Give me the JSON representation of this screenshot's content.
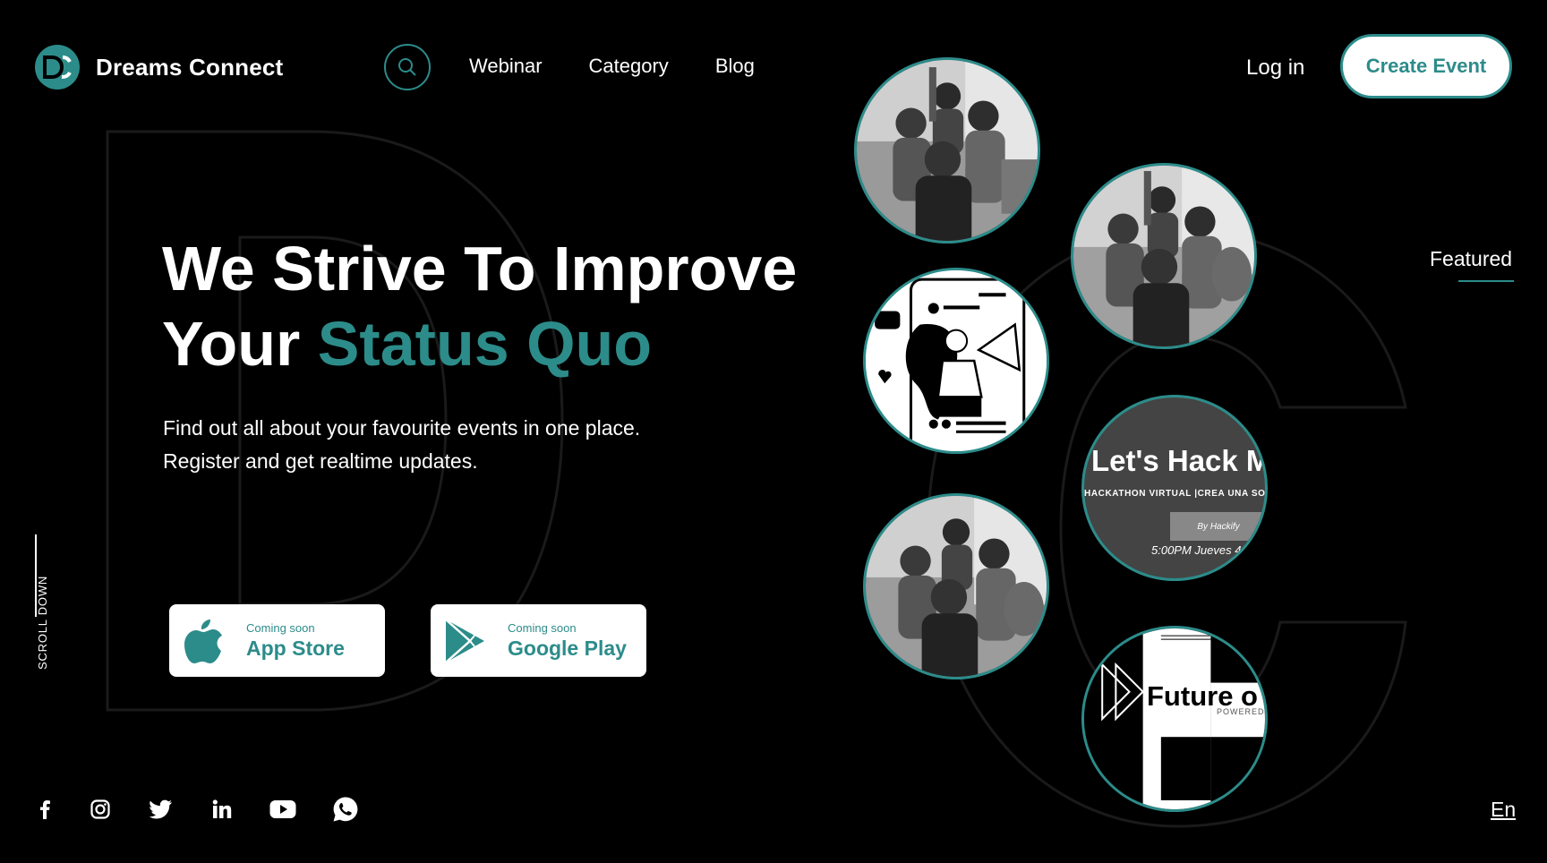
{
  "brand": {
    "logo_letters": "DC",
    "name": "Dreams Connect"
  },
  "colors": {
    "accent": "#2c8c8a",
    "background": "#000000",
    "text": "#ffffff"
  },
  "nav": {
    "search_icon": "search-icon",
    "items": [
      {
        "label": "Webinar"
      },
      {
        "label": "Category"
      },
      {
        "label": "Blog"
      }
    ]
  },
  "auth": {
    "login_label": "Log in",
    "create_label": "Create Event"
  },
  "hero": {
    "title_line1": "We Strive To Improve",
    "title_line2_prefix": "Your ",
    "title_line2_accent": "Status Quo",
    "subtitle_line1": "Find out all about your favourite events in one place.",
    "subtitle_line2": "Register and get realtime updates."
  },
  "stores": [
    {
      "icon": "apple-icon",
      "small": "Coming soon",
      "big": "App Store"
    },
    {
      "icon": "google-play-icon",
      "small": "Coming soon",
      "big": "Google Play"
    }
  ],
  "scroll_label": "SCROLL DOWN",
  "socials": [
    "facebook-icon",
    "instagram-icon",
    "twitter-icon",
    "linkedin-icon",
    "youtube-icon",
    "whatsapp-icon"
  ],
  "featured_label": "Featured",
  "language": "En",
  "event_cards": {
    "hack": {
      "title": "Let's Hack M",
      "subtitle": "HACKATHON VIRTUAL |CREA UNA SOLUC",
      "by": "By Hackify",
      "time": "5:00PM Jueves 4 d"
    },
    "future": {
      "title": "Future o",
      "subtitle": "POWERED"
    }
  }
}
